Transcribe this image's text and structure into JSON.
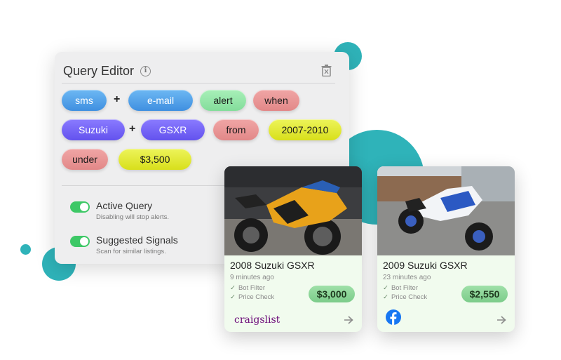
{
  "query_editor": {
    "title": "Query Editor",
    "info_icon": "info-icon",
    "delete_icon": "trash-icon",
    "chips": [
      {
        "label": "sms",
        "color": "blue"
      },
      {
        "label": "e-mail",
        "color": "blue"
      },
      {
        "label": "alert",
        "color": "green"
      },
      {
        "label": "when",
        "color": "red"
      },
      {
        "label": "Suzuki",
        "color": "purple"
      },
      {
        "label": "GSXR",
        "color": "purple"
      },
      {
        "label": "from",
        "color": "red"
      },
      {
        "label": "2007-2010",
        "color": "yellow"
      },
      {
        "label": "under",
        "color": "red"
      },
      {
        "label": "$3,500",
        "color": "yellow"
      }
    ],
    "operators": [
      "+",
      "+"
    ],
    "toggles": [
      {
        "label": "Active Query",
        "description": "Disabling will stop alerts.",
        "on": true
      },
      {
        "label": "Suggested Signals",
        "description": "Scan for similar listings.",
        "on": true
      }
    ]
  },
  "listings": [
    {
      "title": "2008 Suzuki GSXR",
      "time": "9 minutes ago",
      "checks": [
        "Bot Filter",
        "Price Check"
      ],
      "price": "$3,000",
      "source": "craigslist",
      "photo_icon": "orange-motorcycle-photo"
    },
    {
      "title": "2009 Suzuki GSXR",
      "time": "23 minutes ago",
      "checks": [
        "Bot Filter",
        "Price Check"
      ],
      "price": "$2,550",
      "source_icon": "facebook-icon",
      "photo_icon": "blue-white-motorcycle-photo"
    }
  ],
  "colors": {
    "accent_teal": "#2fb3b9",
    "toggle_on": "#3dc866",
    "card_bg": "#f1fbee",
    "price_badge": "#8fd69a",
    "craigslist": "#6b0a78",
    "facebook": "#1877f2"
  }
}
